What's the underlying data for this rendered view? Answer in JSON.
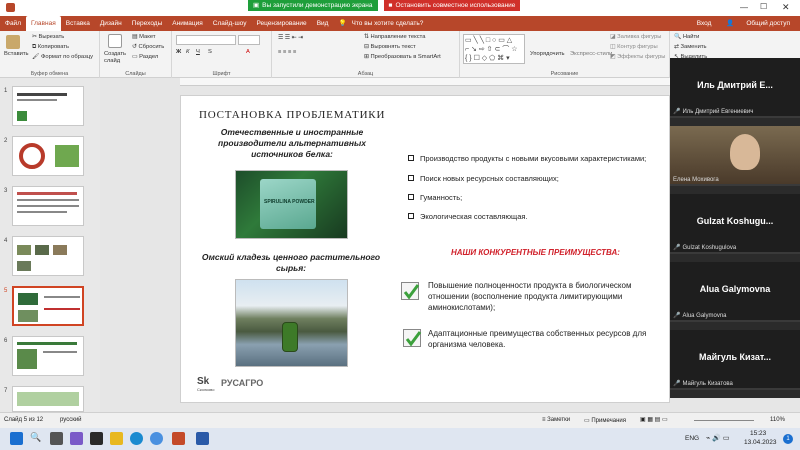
{
  "titlebar": {
    "share_running": "Вы запустили демонстрацию экрана",
    "stop_share": "Остановить совместное использование"
  },
  "tabs": [
    "Файл",
    "Главная",
    "Вставка",
    "Дизайн",
    "Переходы",
    "Анимация",
    "Слайд-шоу",
    "Рецензирование",
    "Вид"
  ],
  "tell_me": "Что вы хотите сделать?",
  "right_actions": {
    "login": "Вход",
    "share": "Общий доступ"
  },
  "ribbon": {
    "clipboard": {
      "paste": "Вставить",
      "cut": "Вырезать",
      "copy": "Копировать",
      "format": "Формат по образцу",
      "label": "Буфер обмена"
    },
    "slides": {
      "create": "Создать слайд",
      "layout": "Макет",
      "reset": "Сбросить",
      "section": "Раздел",
      "label": "Слайды"
    },
    "font": {
      "label": "Шрифт"
    },
    "paragraph": {
      "direction": "Направление текста",
      "align": "Выровнять текст",
      "smartart": "Преобразовать в SmartArt",
      "label": "Абзац"
    },
    "drawing": {
      "arrange": "Упорядочить",
      "quick": "Экспресс-стили",
      "fill": "Заливка фигуры",
      "outline": "Контур фигуры",
      "effects": "Эффекты фигуры",
      "label": "Рисование"
    },
    "editing": {
      "find": "Найти",
      "replace": "Заменить",
      "select": "Выделить"
    }
  },
  "slide": {
    "title": "ПОСТАНОВКА ПРОБЛЕМАТИКИ",
    "left_heading": "Отечественные и иностранные производители альтернативных источников белка:",
    "product_label": "SPIRULINA POWDER",
    "lower_heading": "Омский кладезь ценного растительного сырья:",
    "bullets": [
      "Производство продукты с новыми вкусовыми характеристиками;",
      "Поиск новых ресурсных составляющих;",
      "Гуманность;",
      "Экологическая составляющая."
    ],
    "advantages_title": "НАШИ КОНКУРЕНТНЫЕ ПРЕИМУЩЕСТВА:",
    "adv": [
      {
        "l1": "Повышение полноценности продукта в биологическом",
        "l2": "отношении (восполнение продукта лимитирующими",
        "l3": "аминокислотами);"
      },
      {
        "l1": "Адаптационные преимущества собственных ресурсов для",
        "l2": "организма человека.",
        "l3": ""
      }
    ],
    "logo1": "Sk",
    "logo1_sub": "Сколково",
    "logo2": "РУСАГРО"
  },
  "participants": [
    {
      "display": "Иль Дмитрий Е...",
      "label": "Иль Дмитрий Евгениевич"
    },
    {
      "display": "",
      "label": "Елена Мохивога"
    },
    {
      "display": "Gulzat Koshugu...",
      "label": "Gulzat Koshugulova"
    },
    {
      "display": "Alua Galymovna",
      "label": "Alua Galymovna"
    },
    {
      "display": "Майгуль Кизат...",
      "label": "Майгуль Кизатова"
    }
  ],
  "status": {
    "slide": "Слайд 5 из 12",
    "lang": "русский",
    "notes": "Заметки",
    "comments": "Примечания",
    "zoom": "110%"
  },
  "taskbar": {
    "search": "Поиск",
    "lang": "ENG",
    "time": "15:23",
    "date": "13.04.2023",
    "badge": "1"
  },
  "colors": {
    "accent": "#b7472a",
    "share_green": "#1e9e3a",
    "share_red": "#d0302a",
    "headline_red": "#d0202a"
  }
}
